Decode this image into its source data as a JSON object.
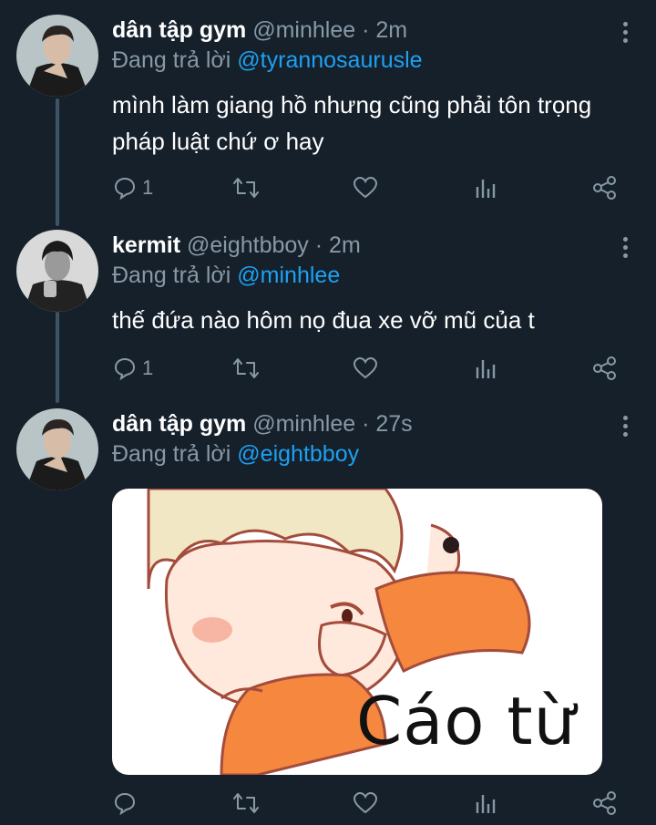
{
  "tweets": [
    {
      "name": "dân tập gym",
      "handle": "@minhlee",
      "separator": "·",
      "time": "2m",
      "reply_prefix": "Đang trả lời",
      "reply_to": "@tyrannosaurusle",
      "text_lines": [
        "mình làm giang hồ nhưng cũng phải tôn trọng",
        "pháp luật chứ ơ hay"
      ],
      "reply_count": "1",
      "avatar_icon": "person-avatar-icon"
    },
    {
      "name": "kermit",
      "handle": "@eightbboy",
      "separator": "·",
      "time": "2m",
      "reply_prefix": "Đang trả lời",
      "reply_to": "@minhlee",
      "text_lines": [
        "thế đứa nào hôm nọ đua xe vỡ mũ của t"
      ],
      "reply_count": "1",
      "avatar_icon": "person-avatar-icon"
    },
    {
      "name": "dân tập gym",
      "handle": "@minhlee",
      "separator": "·",
      "time": "27s",
      "reply_prefix": "Đang trả lời",
      "reply_to": "@eightbboy",
      "media_caption": "Cáo từ",
      "reply_count": "",
      "avatar_icon": "person-avatar-icon"
    }
  ],
  "colors": {
    "background": "#15202b",
    "text": "#ffffff",
    "muted": "#8899a6",
    "accent": "#1da1f2",
    "thread_line": "#3d5466"
  },
  "icons": [
    "reply-icon",
    "retweet-icon",
    "like-icon",
    "analytics-icon",
    "share-icon",
    "more-icon"
  ]
}
